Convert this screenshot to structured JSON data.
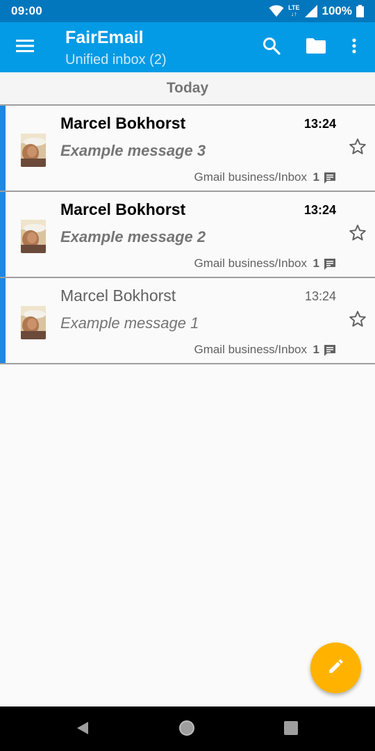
{
  "status_bar": {
    "time": "09:00",
    "network": "LTE",
    "battery": "100%",
    "icons": [
      "wifi-icon",
      "lte-icon",
      "signal-icon",
      "battery-icon"
    ]
  },
  "app_bar": {
    "title": "FairEmail",
    "subtitle": "Unified inbox (2)",
    "icons": [
      "menu-icon",
      "search-icon",
      "folder-icon",
      "more-vert-icon"
    ]
  },
  "section": {
    "label": "Today"
  },
  "messages": [
    {
      "sender": "Marcel Bokhorst",
      "time": "13:24",
      "subject": "Example message 3",
      "folder": "Gmail business/Inbox",
      "count": "1",
      "unread": true
    },
    {
      "sender": "Marcel Bokhorst",
      "time": "13:24",
      "subject": "Example message 2",
      "folder": "Gmail business/Inbox",
      "count": "1",
      "unread": true
    },
    {
      "sender": "Marcel Bokhorst",
      "time": "13:24",
      "subject": "Example message 1",
      "folder": "Gmail business/Inbox",
      "count": "1",
      "unread": false
    }
  ],
  "fab": {
    "icon": "edit-icon"
  },
  "nav_bar": {
    "icons": [
      "back-icon",
      "home-icon",
      "recents-icon"
    ]
  },
  "colors": {
    "status_bar": "#0277bd",
    "app_bar": "#039be5",
    "accent_stripe": "#1e88e5",
    "fab": "#ffb300"
  }
}
